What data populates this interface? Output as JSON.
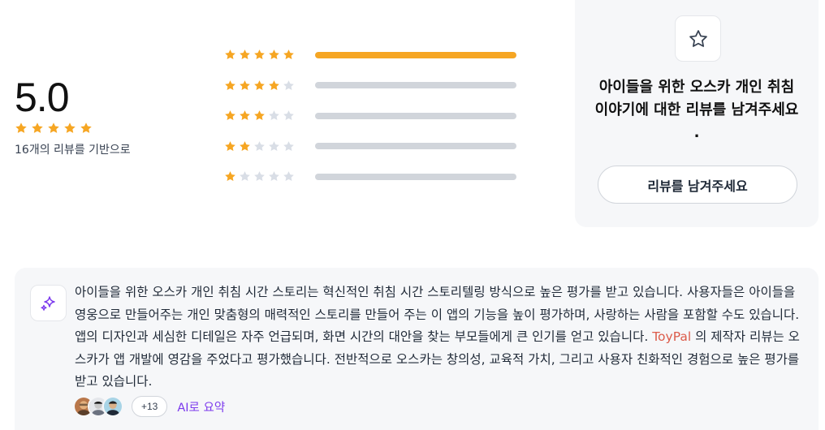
{
  "rating": {
    "score": "5.0",
    "stars_filled": 5,
    "caption": "16개의 리뷰를 기반으로"
  },
  "histogram": [
    {
      "stars": 5,
      "fraction": 1.0
    },
    {
      "stars": 4,
      "fraction": 0.0
    },
    {
      "stars": 3,
      "fraction": 0.0
    },
    {
      "stars": 2,
      "fraction": 0.0
    },
    {
      "stars": 1,
      "fraction": 0.0
    }
  ],
  "cta": {
    "icon": "star-outline-icon",
    "text": "아이들을 위한 오스카 개인 취침 이야기에 대한 리뷰를 남겨주세요 .",
    "button_label": "리뷰를 남겨주세요"
  },
  "summary": {
    "icon": "sparkles-icon",
    "text_before": "아이들을 위한 오스카 개인 취침 시간 스토리는 혁신적인 취침 시간 스토리텔링 방식으로 높은 평가를 받고 있습니다. 사용자들은 아이들을 영웅으로 만들어주는 개인 맞춤형의 매력적인 스토리를 만들어 주는 이 앱의 기능을 높이 평가하며, 사랑하는 사람을 포함할 수도 있습니다. 앱의 디자인과 세심한 디테일은 자주 언급되며, 화면 시간의 대안을 찾는 부모들에게 큰 인기를 얻고 있습니다. ",
    "brand": "ToyPal",
    "text_after": " 의 제작자 리뷰는 오스카가 앱 개발에 영감을 주었다고 평가했습니다. 전반적으로 오스카는 창의성, 교육적 가치, 그리고 사용자 친화적인 경험으로 높은 평가를 받고 있습니다.",
    "more_count": "+13",
    "ai_label": "AI로 요약"
  },
  "colors": {
    "star_filled": "#f6a623",
    "star_empty": "#d9dee6",
    "bar_track": "#d1d5db",
    "bar_fill": "#f6a623",
    "brand": "#dc5b4a",
    "ai": "#7c3aed"
  }
}
